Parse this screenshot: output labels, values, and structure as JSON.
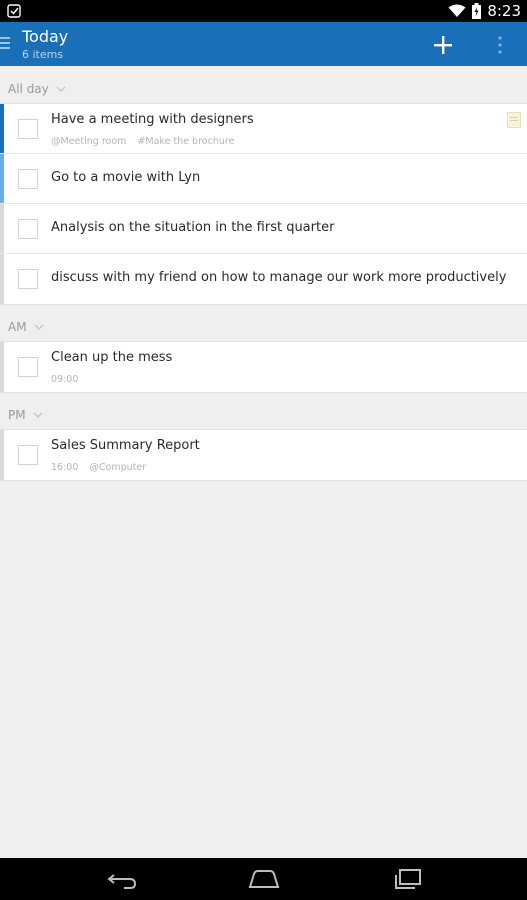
{
  "status_bar": {
    "time": "8:23",
    "icons": [
      "app-check-icon",
      "wifi-icon",
      "battery-icon"
    ]
  },
  "app_bar": {
    "title": "Today",
    "subtitle": "6 items",
    "icons": [
      "menu-icon",
      "add-icon",
      "overflow-menu-icon"
    ],
    "color": "#1a6fb9"
  },
  "sections": [
    {
      "label": "All day",
      "tasks": [
        {
          "title": "Have a meeting with designers",
          "meta": [
            "@Meeting room",
            "#Make the brochure"
          ],
          "stripe_color": "#1a6fb9",
          "has_note": true
        },
        {
          "title": "Go to a movie with Lyn",
          "meta": [],
          "stripe_color": "#6aaee8",
          "has_note": false
        },
        {
          "title": "Analysis on the situation in the first quarter",
          "meta": [],
          "stripe_color": "#d9d9d9",
          "has_note": false
        },
        {
          "title": "discuss with my friend on how to manage our work more productively",
          "meta": [],
          "stripe_color": "#d9d9d9",
          "has_note": false
        }
      ]
    },
    {
      "label": "AM",
      "tasks": [
        {
          "title": "Clean up the mess",
          "meta": [
            "09:00"
          ],
          "stripe_color": "#d9d9d9",
          "has_note": false
        }
      ]
    },
    {
      "label": "PM",
      "tasks": [
        {
          "title": "Sales Summary Report",
          "meta": [
            "16:00",
            "@Computer"
          ],
          "stripe_color": "#d9d9d9",
          "has_note": false
        }
      ]
    }
  ],
  "nav_bar": {
    "icons": [
      "back-icon",
      "home-icon",
      "recents-icon"
    ]
  }
}
